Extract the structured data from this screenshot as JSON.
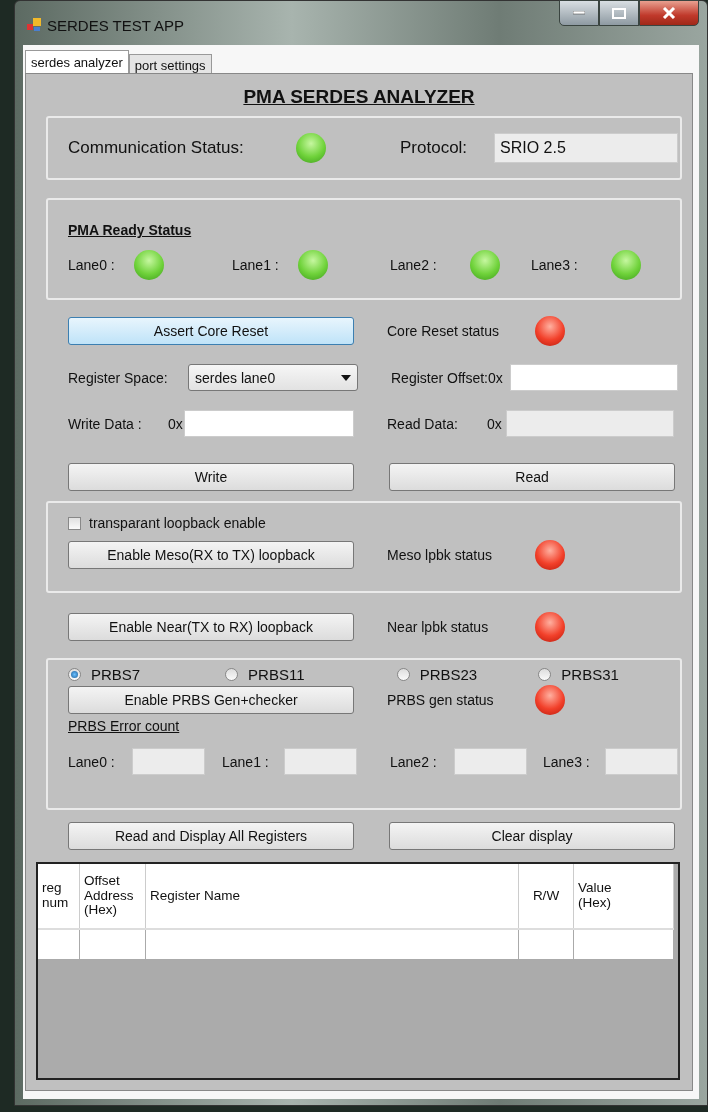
{
  "window": {
    "title": "SERDES TEST APP"
  },
  "tabs": [
    {
      "label": "serdes analyzer",
      "selected": true
    },
    {
      "label": "port settings",
      "selected": false
    }
  ],
  "heading": "PMA SERDES ANALYZER",
  "communication": {
    "label": "Communication Status:",
    "ok": true,
    "protocol_label": "Protocol:",
    "protocol_value": "SRIO 2.5"
  },
  "pma_ready": {
    "title": "PMA Ready Status",
    "lanes": [
      {
        "label": "Lane0 :",
        "ok": true
      },
      {
        "label": "Lane1 :",
        "ok": true
      },
      {
        "label": "Lane2 :",
        "ok": true
      },
      {
        "label": "Lane3 :",
        "ok": true
      }
    ]
  },
  "core_reset": {
    "button": "Assert Core Reset",
    "status_label": "Core Reset status",
    "ok": false
  },
  "register_space": {
    "label": "Register Space:",
    "value": "serdes lane0"
  },
  "register_offset": {
    "label": "Register Offset:0x"
  },
  "write_data": {
    "label": "Write Data :",
    "prefix": "0x"
  },
  "read_data": {
    "label": "Read Data:",
    "prefix": "0x"
  },
  "write_button": "Write",
  "read_button": "Read",
  "loopback": {
    "checkbox_label": "transparant loopback enable",
    "checked": false,
    "meso": {
      "button": "Enable Meso(RX to TX) loopback",
      "status_label": "Meso lpbk status",
      "ok": false
    }
  },
  "near": {
    "button": "Enable Near(TX to RX) loopback",
    "status_label": "Near lpbk status",
    "ok": false
  },
  "prbs": {
    "options": [
      {
        "label": "PRBS7",
        "selected": true
      },
      {
        "label": "PRBS11",
        "selected": false
      },
      {
        "label": "PRBS23",
        "selected": false
      },
      {
        "label": "PRBS31",
        "selected": false
      }
    ],
    "button": "Enable PRBS Gen+checker",
    "status_label": "PRBS gen status",
    "ok": false,
    "error_count_title": "PRBS Error count",
    "lanes": [
      {
        "label": "Lane0 :"
      },
      {
        "label": "Lane1 :"
      },
      {
        "label": "Lane2 :"
      },
      {
        "label": "Lane3 :"
      }
    ]
  },
  "read_all_button": "Read and Display All Registers",
  "clear_button": "Clear display",
  "table": {
    "columns": [
      {
        "label": "reg num"
      },
      {
        "label": "Offset Address (Hex)"
      },
      {
        "label": "Register Name"
      },
      {
        "label": "R/W"
      },
      {
        "label": "Value (Hex)"
      }
    ]
  }
}
